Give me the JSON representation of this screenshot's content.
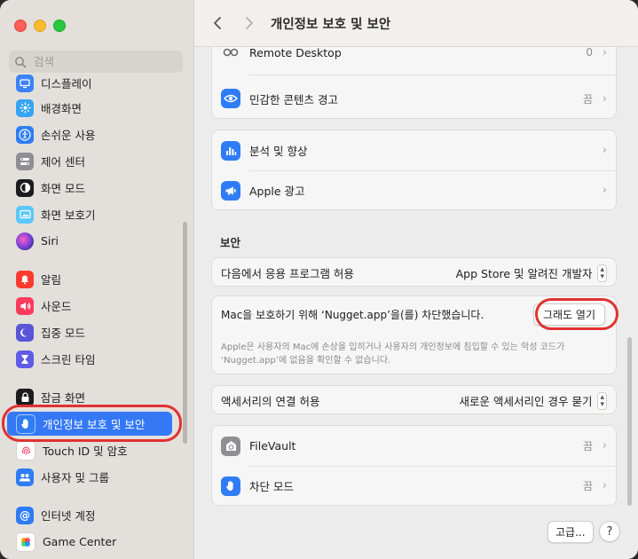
{
  "window": {
    "title": "개인정보 보호 및 보안"
  },
  "search": {
    "placeholder": "검색"
  },
  "sidebar": {
    "items": [
      {
        "label": "디스플레이",
        "icon": "display-icon",
        "color": "#3b82f6"
      },
      {
        "label": "배경화면",
        "icon": "wallpaper-icon",
        "color": "#36a3f5"
      },
      {
        "label": "손쉬운 사용",
        "icon": "accessibility-icon",
        "color": "#2f7cf6"
      },
      {
        "label": "제어 센터",
        "icon": "control-center-icon",
        "color": "#8e8e93"
      },
      {
        "label": "화면 모드",
        "icon": "appearance-icon",
        "color": "#1c1c1e"
      },
      {
        "label": "화면 보호기",
        "icon": "screensaver-icon",
        "color": "#5ac8fa"
      },
      {
        "label": "Siri",
        "icon": "siri-icon",
        "color": "#6e3fd8"
      },
      {
        "label": "알림",
        "icon": "bell-icon",
        "color": "#ff3b30"
      },
      {
        "label": "사운드",
        "icon": "speaker-icon",
        "color": "#ff3b5c"
      },
      {
        "label": "집중 모드",
        "icon": "moon-icon",
        "color": "#5856d6"
      },
      {
        "label": "스크린 타임",
        "icon": "hourglass-icon",
        "color": "#5e5ce6"
      },
      {
        "label": "잠금 화면",
        "icon": "lock-icon",
        "color": "#1c1c1e"
      },
      {
        "label": "개인정보 보호 및 보안",
        "icon": "hand-icon",
        "color": "#2f7cf6"
      },
      {
        "label": "Touch ID 및 암호",
        "icon": "fingerprint-icon",
        "color": "#ffffff"
      },
      {
        "label": "사용자 및 그룹",
        "icon": "users-icon",
        "color": "#2f7cf6"
      },
      {
        "label": "인터넷 계정",
        "icon": "at-icon",
        "color": "#2f7cf6"
      },
      {
        "label": "Game Center",
        "icon": "game-center-icon",
        "color": "#ffffff"
      }
    ]
  },
  "rows": {
    "remote_desktop": {
      "label": "Remote Desktop",
      "value": "0"
    },
    "sensitive": {
      "label": "민감한 콘텐츠 경고",
      "value": "끔"
    },
    "analytics": {
      "label": "분석 및 향상"
    },
    "apple_ads": {
      "label": "Apple 광고"
    }
  },
  "security": {
    "title": "보안",
    "allow_apps_label": "다음에서 응용 프로그램 허용",
    "allow_apps_value": "App Store 및 알려진 개발자",
    "blocked_message": "Mac을 보호하기 위해 ‘Nugget.app’을(를) 차단했습니다.",
    "open_anyway": "그래도 열기",
    "note": "Apple은 사용자의 Mac에 손상을 입히거나 사용자의 개인정보에 침입할 수 있는 악성 코드가 ‘Nugget.app’에 없음을 확인할 수 없습니다.",
    "accessory_label": "액세서리의 연결 허용",
    "accessory_value": "새로운 액세서리인 경우 묻기",
    "filevault_label": "FileVault",
    "filevault_value": "끔",
    "lockdown_label": "차단 모드",
    "lockdown_value": "끔"
  },
  "footer": {
    "advanced": "고급...",
    "help": "?"
  },
  "colors": {
    "accent": "#3478f6",
    "highlight": "#e03131"
  }
}
